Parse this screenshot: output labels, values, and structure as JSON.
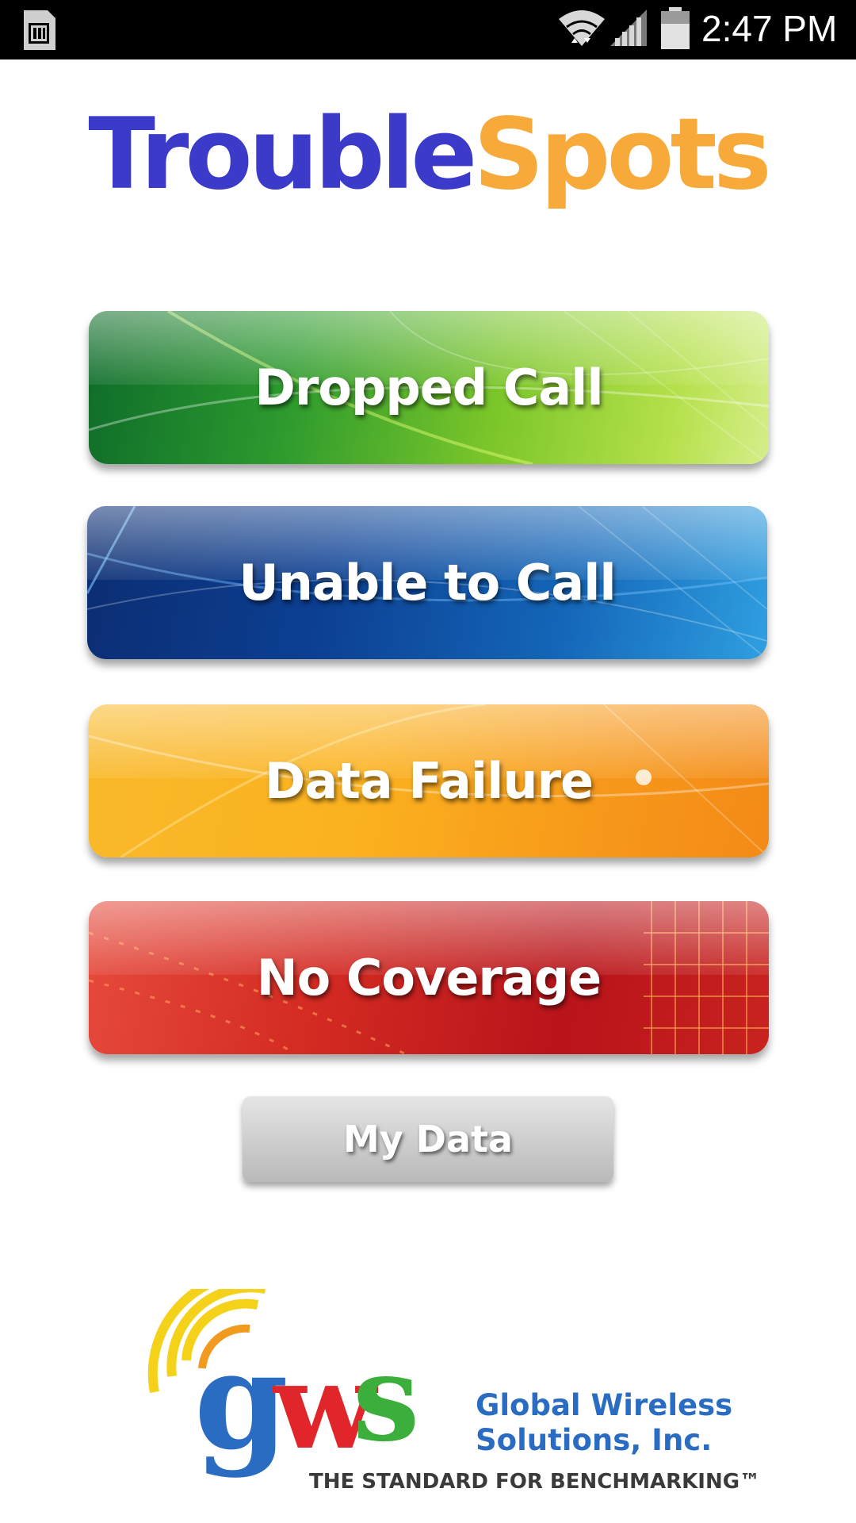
{
  "status_bar": {
    "time": "2:47 PM",
    "icons": [
      "sim-card-icon",
      "wifi-icon",
      "signal-icon",
      "battery-icon"
    ]
  },
  "app": {
    "title_part1": "Trouble",
    "title_part2": "Spots",
    "title_colors": {
      "part1": "#3c3ac9",
      "part2": "#f7a93a"
    }
  },
  "buttons": {
    "dropped_call": "Dropped Call",
    "unable_to_call": "Unable to Call",
    "data_failure": "Data Failure",
    "no_coverage": "No Coverage",
    "my_data": "My Data"
  },
  "footer": {
    "logo_letters": "gws",
    "company_line1": "Global Wireless",
    "company_line2": "Solutions, Inc.",
    "tagline": "THE STANDARD FOR BENCHMARKING™"
  }
}
